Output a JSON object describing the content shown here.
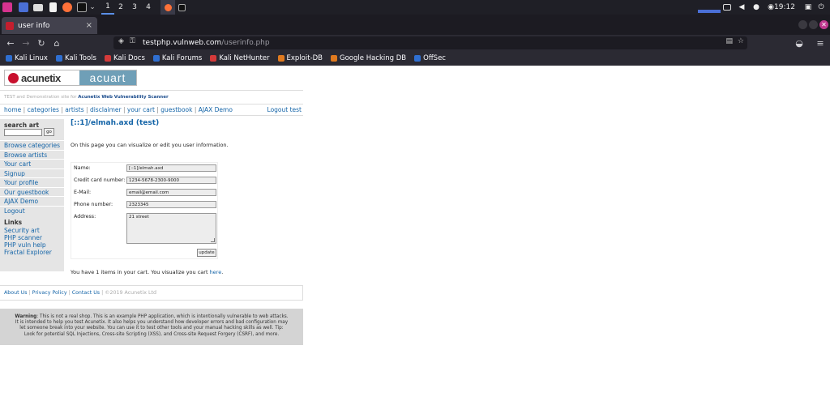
{
  "taskbar": {
    "workspaces": [
      "1",
      "2",
      "3",
      "4"
    ],
    "clock": "19:12"
  },
  "browser": {
    "tab_title": "user info",
    "tab_close": "×",
    "new_tab": "+",
    "url_host": "testphp.vulnweb.com",
    "url_path": "/userinfo.php",
    "bookmarks": [
      {
        "label": "Kali Linux",
        "color": "#2f6fd1"
      },
      {
        "label": "Kali Tools",
        "color": "#2f6fd1"
      },
      {
        "label": "Kali Docs",
        "color": "#d43a3a"
      },
      {
        "label": "Kali Forums",
        "color": "#2f6fd1"
      },
      {
        "label": "Kali NetHunter",
        "color": "#d43a3a"
      },
      {
        "label": "Exploit-DB",
        "color": "#e07a1f"
      },
      {
        "label": "Google Hacking DB",
        "color": "#e07a1f"
      },
      {
        "label": "OffSec",
        "color": "#2f6fd1"
      }
    ]
  },
  "site": {
    "logo_left": "acunetix",
    "logo_right": "acuart",
    "subtitle_prefix": "TEST and Demonstration site for ",
    "subtitle_link": "Acunetix Web Vulnerability Scanner",
    "menu": [
      "home",
      "categories",
      "artists",
      "disclaimer",
      "your cart",
      "guestbook",
      "AJAX Demo"
    ],
    "logout": "Logout test",
    "search_title": "search art",
    "search_button": "go",
    "sidebar_items": [
      "Browse categories",
      "Browse artists",
      "Your cart",
      "Signup",
      "Your profile",
      "Our guestbook",
      "AJAX Demo",
      "Logout"
    ],
    "links_title": "Links",
    "sidebar_links": [
      "Security art",
      "PHP scanner",
      "PHP vuln help",
      "Fractal Explorer"
    ]
  },
  "content": {
    "heading": "[::1]/elmah.axd (test)",
    "intro": "On this page you can visualize or edit you user information.",
    "form": {
      "name_label": "Name:",
      "name_value": "[::1]/elmah.axd",
      "card_label": "Credit card number:",
      "card_value": "1234-5678-2300-9000",
      "email_label": "E-Mail:",
      "email_value": "email@email.com",
      "phone_label": "Phone number:",
      "phone_value": "2323345",
      "address_label": "Address:",
      "address_value": "21 street",
      "update_button": "update"
    },
    "cart_text": "You have 1 items in your cart. You visualize you cart ",
    "cart_link": "here",
    "cart_end": "."
  },
  "footer": {
    "links": [
      "About Us",
      "Privacy Policy",
      "Contact Us"
    ],
    "copyright": "©2019 Acunetix Ltd",
    "warning_label": "Warning",
    "warning_text": ": This is not a real shop. This is an example PHP application, which is intentionally vulnerable to web attacks. It is intended to help you test Acunetix. It also helps you understand how developer errors and bad configuration may let someone break into your website. You can use it to test other tools and your manual hacking skills as well. Tip: Look for potential SQL Injections, Cross-site Scripting (XSS), and Cross-site Request Forgery (CSRF), and more."
  }
}
